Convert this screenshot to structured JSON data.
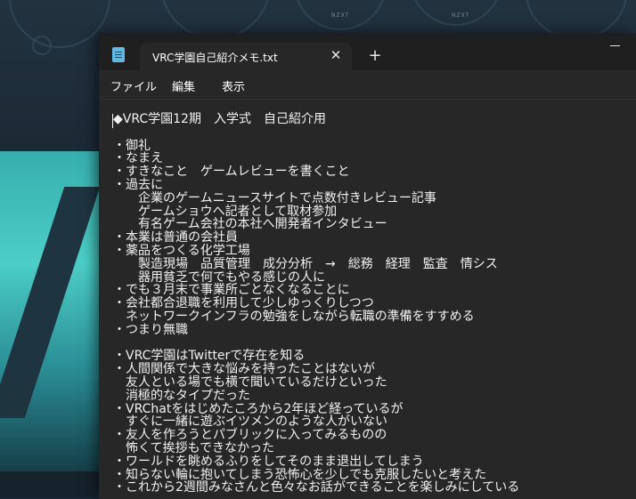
{
  "window": {
    "tab_title": "VRC学園自己紹介メモ.txt",
    "close_glyph": "✕",
    "new_tab_glyph": "+"
  },
  "wallpaper": {
    "fan_brand": "NZXT"
  },
  "menu": {
    "items": [
      {
        "label": "ファイル"
      },
      {
        "label": "編集"
      },
      {
        "label": "表示"
      }
    ]
  },
  "editor": {
    "lines": [
      "◆VRC学園12期　入学式　自己紹介用",
      "",
      "・御礼",
      "・なまえ",
      "・すきなこと　ゲームレビューを書くこと",
      "・過去に",
      "　　企業のゲームニュースサイトで点数付きレビュー記事",
      "　　ゲームショウへ記者として取材参加",
      "　　有名ゲーム会社の本社へ開発者インタビュー",
      "・本業は普通の会社員",
      "・薬品をつくる化学工場",
      "　　製造現場　品質管理　成分分析　→　総務　経理　監査　情シス",
      "　　器用貧乏で何でもやる感じの人に",
      "・でも３月末で事業所ごとなくなることに",
      "・会社都合退職を利用して少しゆっくりしつつ",
      "　ネットワークインフラの勉強をしながら転職の準備をすすめる",
      "・つまり無職",
      "",
      "・VRC学園はTwitterで存在を知る",
      "・人間関係で大きな悩みを持ったことはないが",
      "　友人といる場でも横で聞いているだけといった",
      "　消極的なタイプだった",
      "・VRChatをはじめたころから2年ほど経っているが",
      "　すぐに一緒に遊ぶイツメンのような人がいない",
      "・友人を作ろうとパブリックに入ってみるものの",
      "　怖くて挨拶もできなかった",
      "・ワールドを眺めるふりをしてそのまま退出してしまう",
      "・知らない輪に抱いてしまう恐怖心を少しでも克服したいと考えた",
      "・これから2週間みなさんと色々なお話ができることを楽しみにしている"
    ]
  }
}
